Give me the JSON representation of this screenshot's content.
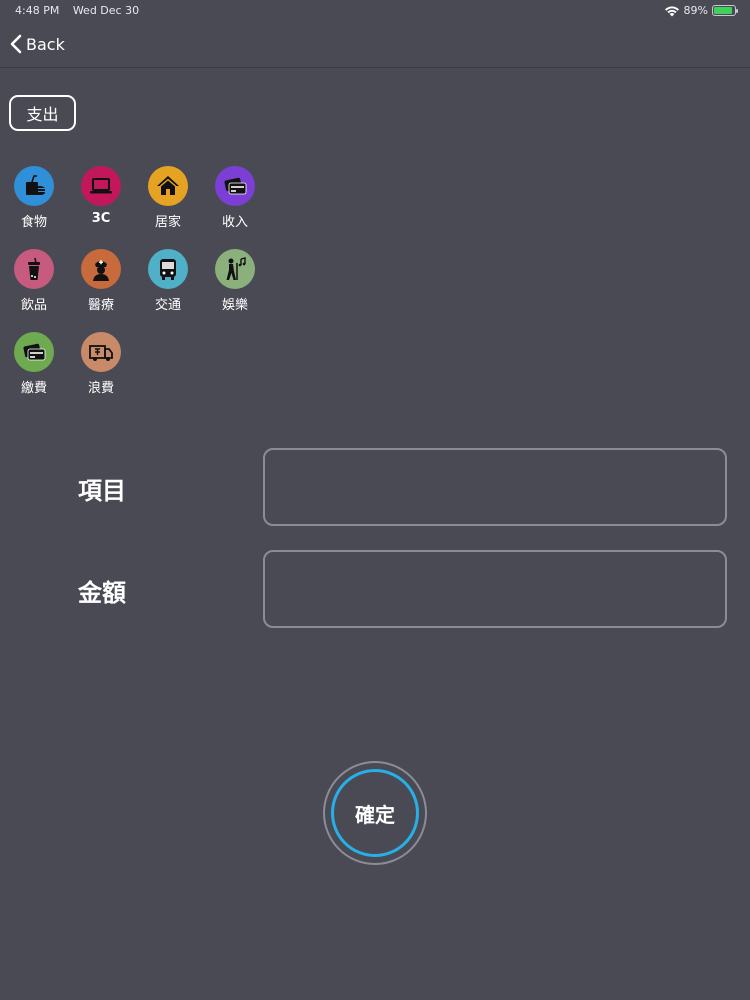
{
  "status_bar": {
    "time": "4:48 PM",
    "date": "Wed Dec 30",
    "battery": "89%",
    "battery_level": 0.89
  },
  "nav": {
    "back_label": "Back"
  },
  "type_toggle": {
    "label": "支出"
  },
  "categories": [
    {
      "label": "食物",
      "color": "#2f8fd8",
      "icon": "fast-food-icon"
    },
    {
      "label": "3C",
      "color": "#c2185b",
      "icon": "laptop-icon"
    },
    {
      "label": "居家",
      "color": "#e6a323",
      "icon": "house-icon"
    },
    {
      "label": "收入",
      "color": "#7b3fd6",
      "icon": "wallet-card-icon"
    },
    {
      "label": "飲品",
      "color": "#c65a7f",
      "icon": "drink-cup-icon"
    },
    {
      "label": "醫療",
      "color": "#c76a3c",
      "icon": "nurse-icon"
    },
    {
      "label": "交通",
      "color": "#4fb0c8",
      "icon": "bus-icon"
    },
    {
      "label": "娛樂",
      "color": "#8bb07c",
      "icon": "hiker-music-icon"
    },
    {
      "label": "繳費",
      "color": "#6eaa4f",
      "icon": "wallet-card-icon"
    },
    {
      "label": "浪費",
      "color": "#c98a6a",
      "icon": "delivery-truck-icon"
    }
  ],
  "form": {
    "item_label": "項目",
    "item_value": "",
    "amount_label": "金額",
    "amount_value": ""
  },
  "confirm": {
    "label": "確定"
  }
}
